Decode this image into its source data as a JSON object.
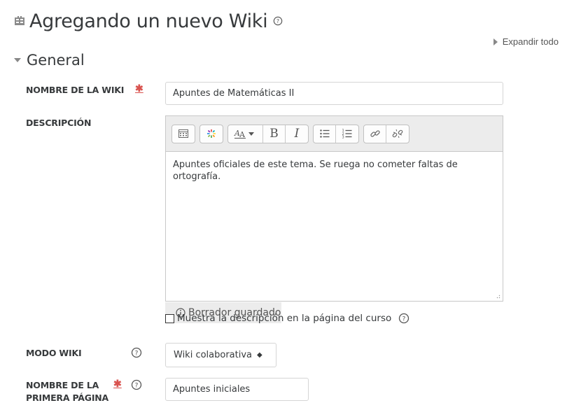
{
  "page": {
    "title": "Agregando un nuevo Wiki",
    "title_icon": "wiki-module-icon",
    "expand_all": "Expandir todo"
  },
  "section": {
    "title": "General"
  },
  "fields": {
    "wiki_name": {
      "label": "NOMBRE DE LA WIKI",
      "required_mark": "✱",
      "value": "Apuntes de Matemáticas II"
    },
    "description": {
      "label": "DESCRIPCIÓN",
      "content": "Apuntes oficiales de este tema. Se ruega no cometer faltas de ortografía.",
      "draft_status": "Borrador guardado",
      "toolbar": [
        "toolbar-toggle-icon",
        "media-icon",
        "font-style-icon",
        "bold-icon",
        "italic-icon",
        "unordered-list-icon",
        "ordered-list-icon",
        "link-icon",
        "unlink-icon"
      ],
      "bold_label": "B",
      "italic_label": "I",
      "show_on_course_page": "Muestra la descripción en la página del curso"
    },
    "wiki_mode": {
      "label": "MODO WIKI",
      "value": "Wiki colaborativa",
      "arrows": "◆"
    },
    "first_page_name": {
      "label_line1": "NOMBRE DE LA",
      "label_line2": "PRIMERA PÁGINA",
      "required_mark": "✱",
      "value": "Apuntes iniciales"
    }
  },
  "colors": {
    "required": "#d9534f",
    "text": "#373a3c",
    "toolbar_bg": "#ececec"
  }
}
